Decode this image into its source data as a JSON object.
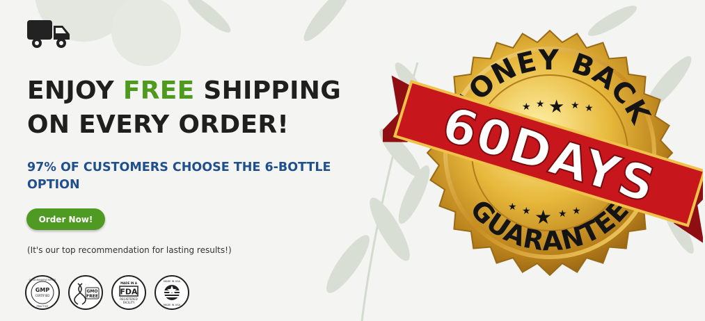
{
  "icons": {
    "truck": "truck-icon",
    "stars": "star-icon"
  },
  "colors": {
    "accent_green": "#4e9a1f",
    "heading": "#1f1f1f",
    "sub_blue": "#1f4f8d",
    "gold": "#d9a92a",
    "ribbon_red": "#c8161d"
  },
  "hero": {
    "line1_pre": "ENJOY ",
    "line1_free": "FREE",
    "line1_post": " SHIPPING",
    "line2": "ON EVERY ORDER!",
    "subheading": "97% OF CUSTOMERS CHOOSE THE 6-BOTTLE OPTION",
    "cta": "Order Now!",
    "note": "(It's our top recommendation for lasting results!)"
  },
  "badges": [
    {
      "icon": "gmp-badge-icon",
      "lines": [
        "GOOD MANUFACTURING",
        "GMP",
        "CERTIFIED",
        "PRACTICE"
      ]
    },
    {
      "icon": "gmo-free-badge-icon",
      "lines": [
        "GMO",
        "FREE"
      ]
    },
    {
      "icon": "fda-badge-icon",
      "lines": [
        "MADE IN A",
        "FDA",
        "REGISTERED",
        "FACILITY"
      ]
    },
    {
      "icon": "made-in-usa-badge-icon",
      "lines": [
        "MADE IN USA",
        "MADE IN USA"
      ]
    }
  ],
  "seal": {
    "top_arc": "MONEY BACK",
    "ribbon": "60DAYS",
    "bottom_arc": "GUARANTEE"
  }
}
